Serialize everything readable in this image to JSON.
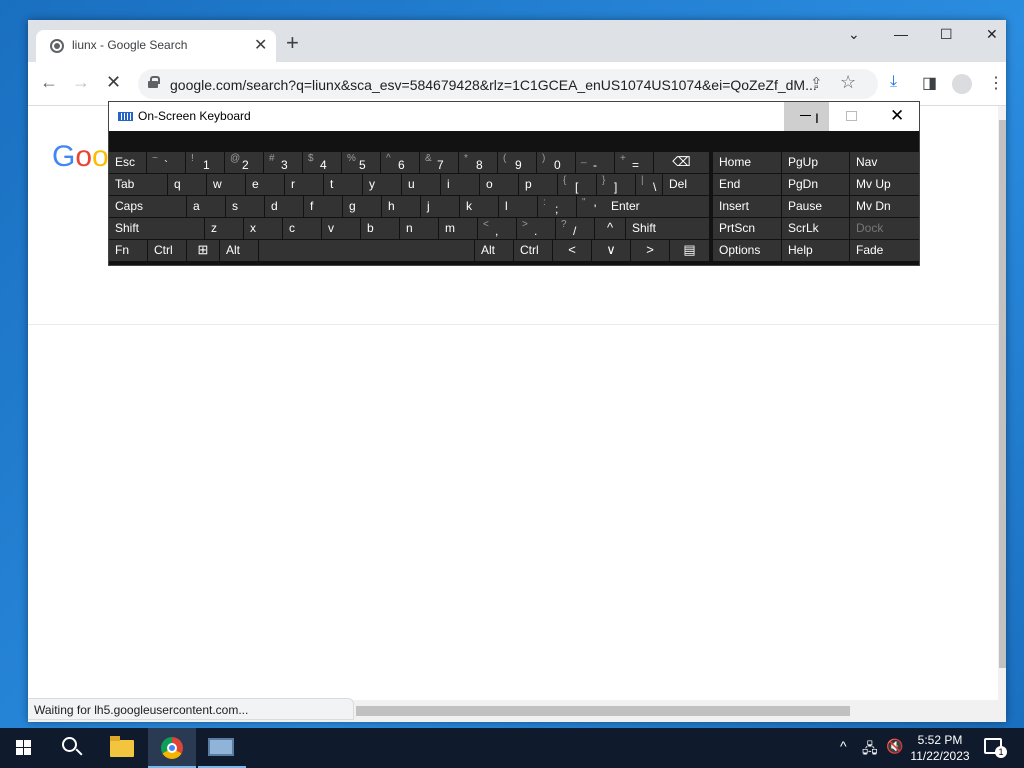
{
  "browser": {
    "tab_title": "liunx - Google Search",
    "tab_close": "✕",
    "new_tab": "+",
    "window_controls": {
      "dropdown": "⌄",
      "minimize": "—",
      "maximize": "☐",
      "close": "✕"
    },
    "url": "google.com/search?q=liunx&sca_esv=584679428&rlz=1C1GCEA_enUS1074US1074&ei=QoZeZf_dM...",
    "back": "←",
    "forward": "→",
    "reload_stop": "✕",
    "status_text": "Waiting for lh5.googleusercontent.com...",
    "logo_text": "Goo"
  },
  "osk": {
    "title": "On-Screen Keyboard",
    "close": "✕",
    "rows": {
      "row1": [
        {
          "label": "Esc"
        },
        {
          "shift": "~",
          "main": "`"
        },
        {
          "shift": "!",
          "main": "1"
        },
        {
          "shift": "@",
          "main": "2"
        },
        {
          "shift": "#",
          "main": "3"
        },
        {
          "shift": "$",
          "main": "4"
        },
        {
          "shift": "%",
          "main": "5"
        },
        {
          "shift": "^",
          "main": "6"
        },
        {
          "shift": "&",
          "main": "7"
        },
        {
          "shift": "*",
          "main": "8"
        },
        {
          "shift": "(",
          "main": "9"
        },
        {
          "shift": ")",
          "main": "0"
        },
        {
          "shift": "_",
          "main": "-"
        },
        {
          "shift": "+",
          "main": "="
        },
        {
          "label": "⌫"
        }
      ],
      "row2": [
        {
          "label": "Tab"
        },
        {
          "label": "q"
        },
        {
          "label": "w"
        },
        {
          "label": "e"
        },
        {
          "label": "r"
        },
        {
          "label": "t"
        },
        {
          "label": "y"
        },
        {
          "label": "u"
        },
        {
          "label": "i"
        },
        {
          "label": "o"
        },
        {
          "label": "p"
        },
        {
          "shift": "{",
          "main": "["
        },
        {
          "shift": "}",
          "main": "]"
        },
        {
          "shift": "|",
          "main": "\\"
        },
        {
          "label": "Del"
        }
      ],
      "row3": [
        {
          "label": "Caps"
        },
        {
          "label": "a"
        },
        {
          "label": "s"
        },
        {
          "label": "d"
        },
        {
          "label": "f"
        },
        {
          "label": "g"
        },
        {
          "label": "h"
        },
        {
          "label": "j"
        },
        {
          "label": "k"
        },
        {
          "label": "l"
        },
        {
          "shift": ":",
          "main": ";"
        },
        {
          "shift": "\"",
          "main": "'"
        },
        {
          "label": "Enter"
        }
      ],
      "row4": [
        {
          "label": "Shift"
        },
        {
          "label": "z"
        },
        {
          "label": "x"
        },
        {
          "label": "c"
        },
        {
          "label": "v"
        },
        {
          "label": "b"
        },
        {
          "label": "n"
        },
        {
          "label": "m"
        },
        {
          "shift": "<",
          "main": ","
        },
        {
          "shift": ">",
          "main": "."
        },
        {
          "shift": "?",
          "main": "/"
        },
        {
          "label": "^"
        },
        {
          "label": "Shift"
        }
      ],
      "row5": [
        {
          "label": "Fn"
        },
        {
          "label": "Ctrl"
        },
        {
          "label": "⊞"
        },
        {
          "label": "Alt"
        },
        {
          "label": ""
        },
        {
          "label": "Alt"
        },
        {
          "label": "Ctrl"
        },
        {
          "label": "<"
        },
        {
          "label": "∨"
        },
        {
          "label": ">"
        },
        {
          "label": "▤"
        }
      ]
    },
    "nav": {
      "col1": [
        "Home",
        "End",
        "Insert",
        "PrtScn",
        "Options"
      ],
      "col2": [
        "PgUp",
        "PgDn",
        "Pause",
        "ScrLk",
        "Help"
      ],
      "col3": [
        "Nav",
        "Mv Up",
        "Mv Dn",
        "Dock",
        "Fade"
      ]
    }
  },
  "taskbar": {
    "time": "5:52 PM",
    "date": "11/22/2023",
    "notification_count": "1",
    "tray_chevron": "^"
  },
  "colors": {
    "osk_key": "#333333",
    "osk_bg": "#121212",
    "taskbar": "#0f1b2d",
    "desktop": "#1d75c6"
  }
}
